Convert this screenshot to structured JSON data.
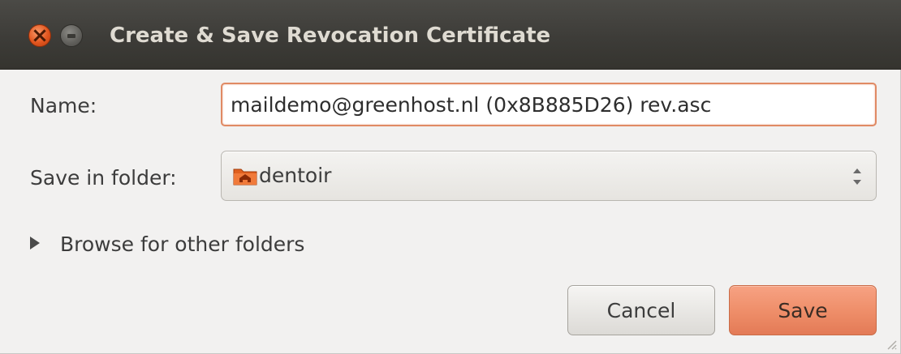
{
  "window": {
    "title": "Create & Save Revocation Certificate",
    "close_icon": "close-icon",
    "minimize_icon": "minimize-icon"
  },
  "form": {
    "name_label": "Name:",
    "name_value": "maildemo@greenhost.nl (0x8B885D26) rev.asc",
    "folder_label": "Save in folder:",
    "folder_value": "dentoir",
    "folder_icon": "home-folder-icon",
    "browse_label": "Browse for other folders"
  },
  "buttons": {
    "cancel_label": "Cancel",
    "save_label": "Save"
  },
  "colors": {
    "titlebar": "#3c3b37",
    "accent": "#ee8d68",
    "focus_border": "#e08a64"
  }
}
